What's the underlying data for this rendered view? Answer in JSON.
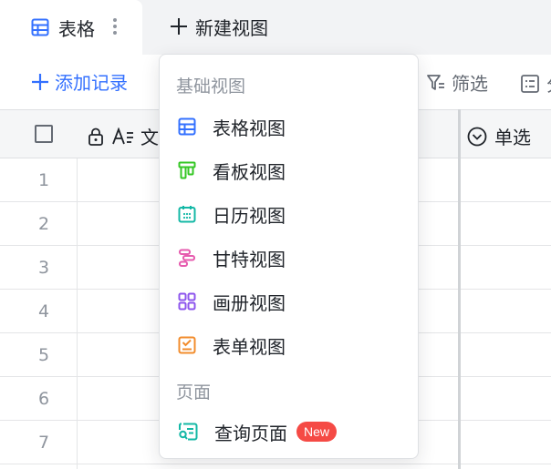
{
  "tabs": {
    "active_label": "表格",
    "new_view_label": "新建视图"
  },
  "toolbar": {
    "add_record_label": "添加记录",
    "filter_label": "筛选",
    "group_label_partial": "分"
  },
  "grid": {
    "columns": [
      {
        "label_partial": "文",
        "type": "text",
        "locked": true
      },
      {
        "label": "单选",
        "type": "single-select"
      }
    ],
    "row_numbers": [
      "1",
      "2",
      "3",
      "4",
      "5",
      "6",
      "7"
    ]
  },
  "dropdown": {
    "section_basic": "基础视图",
    "items": [
      {
        "label": "表格视图",
        "icon": "grid-view-icon",
        "color": "#3370ff"
      },
      {
        "label": "看板视图",
        "icon": "kanban-view-icon",
        "color": "#34c724"
      },
      {
        "label": "日历视图",
        "icon": "calendar-view-icon",
        "color": "#14b8a6"
      },
      {
        "label": "甘特视图",
        "icon": "gantt-view-icon",
        "color": "#e65bae"
      },
      {
        "label": "画册视图",
        "icon": "gallery-view-icon",
        "color": "#8d55ed"
      },
      {
        "label": "表单视图",
        "icon": "form-view-icon",
        "color": "#f28c2c"
      }
    ],
    "section_page": "页面",
    "page_items": [
      {
        "label": "查询页面",
        "icon": "query-page-icon",
        "color": "#14b8a6",
        "badge": "New"
      }
    ]
  },
  "colors": {
    "accent": "#3370ff",
    "badge": "#f54a45"
  }
}
